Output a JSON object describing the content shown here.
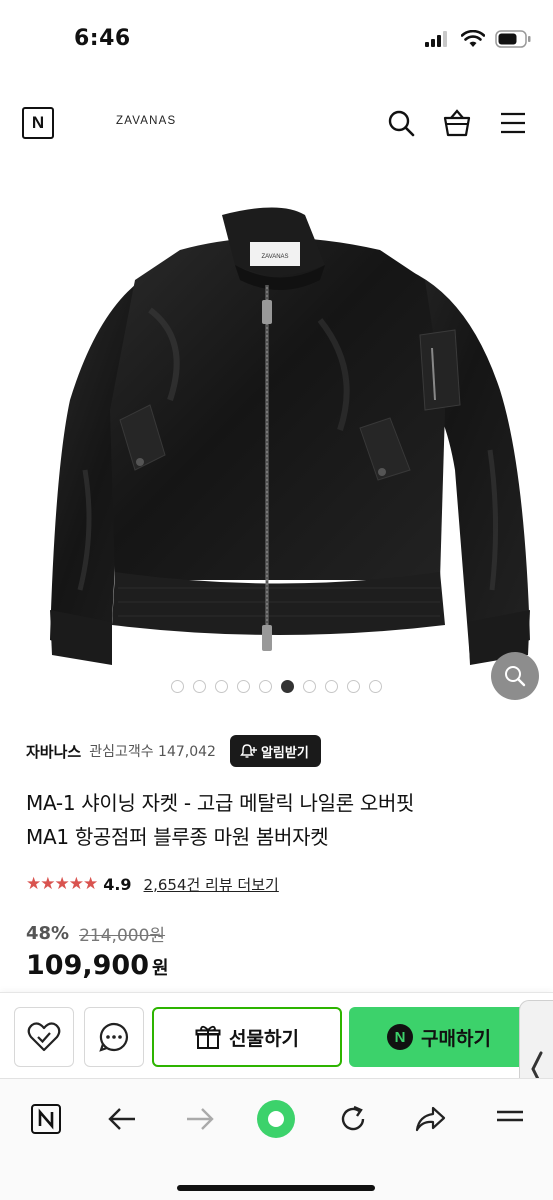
{
  "status_bar": {
    "time": "6:46",
    "signal_icon": "signal-bars-icon",
    "wifi_icon": "wifi-icon",
    "battery_icon": "battery-icon"
  },
  "header": {
    "logo_letter": "N",
    "brand_name": "ZAVANAS",
    "search_icon": "search-icon",
    "cart_icon": "shopping-bag-icon",
    "menu_icon": "hamburger-menu-icon"
  },
  "gallery": {
    "image_label": "ZAVANAS",
    "total_images": 10,
    "active_index": 5,
    "zoom_icon": "zoom-icon"
  },
  "product": {
    "seller_name": "자바나스",
    "interest_label": "관심고객수 147,042",
    "alarm_button": "알림받기",
    "title_line1": "MA-1 샤이닝 자켓 - 고급 메탈릭 나일론 오버핏",
    "title_line2": "MA1 항공점퍼 블루종 마원 봄버자켓",
    "stars": "★★★★★",
    "rating": "4.9",
    "review_link": "2,654건 리뷰 더보기",
    "discount": "48%",
    "original_price": "214,000원",
    "price": "109,900",
    "currency": "원"
  },
  "actions": {
    "wishlist_icon": "heart-check-icon",
    "chat_icon": "chat-bubble-icon",
    "gift_label": "선물하기",
    "buy_label": "구매하기",
    "npay_letter": "N"
  },
  "browser": {
    "home_icon": "naver-n-icon",
    "back_icon": "arrow-left-icon",
    "forward_icon": "arrow-right-icon",
    "center_icon": "green-circle-icon",
    "refresh_icon": "refresh-icon",
    "share_icon": "share-icon",
    "menu_icon": "menu-lines-icon"
  },
  "colors": {
    "naver_green": "#3cd26b",
    "gift_border": "#2db400",
    "star": "#d9534f"
  }
}
